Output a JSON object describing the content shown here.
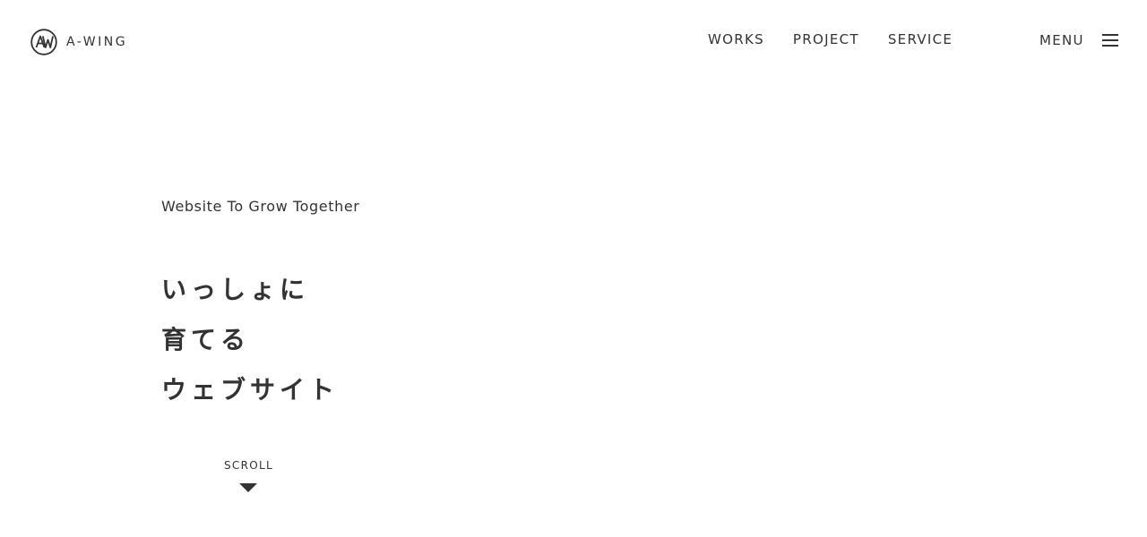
{
  "header": {
    "logo_text": "A-WING",
    "logo_icon": "aw-circle-logo"
  },
  "nav": {
    "items": [
      {
        "label": "WORKS"
      },
      {
        "label": "PROJECT"
      },
      {
        "label": "SERVICE"
      }
    ],
    "menu_label": "MENU",
    "menu_icon": "hamburger-icon"
  },
  "hero": {
    "tagline": "Website To Grow Together",
    "headline_lines": [
      "いっしょに",
      "育てる",
      "ウェブサイト"
    ]
  },
  "scroll": {
    "label": "SCROLL",
    "icon": "triangle-down-icon"
  },
  "colors": {
    "text": "#333333",
    "background": "#ffffff"
  }
}
